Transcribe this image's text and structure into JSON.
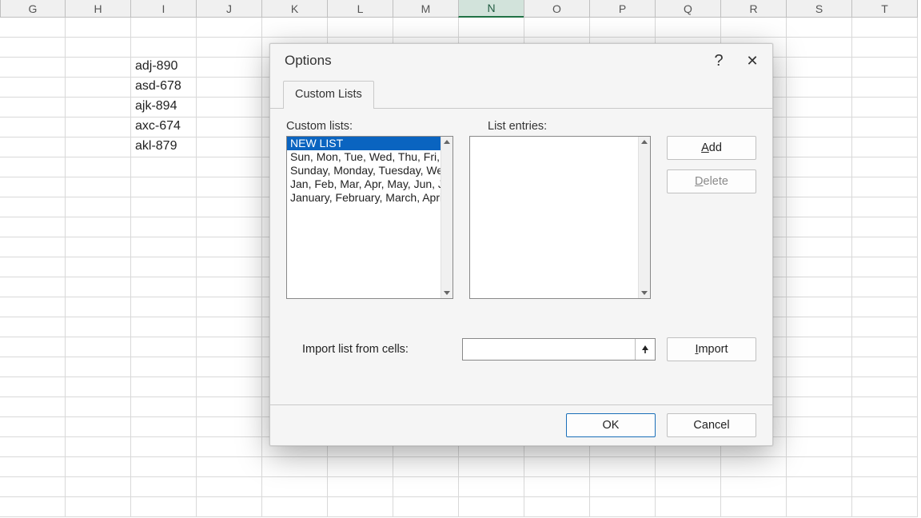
{
  "columns": [
    "G",
    "H",
    "I",
    "J",
    "K",
    "L",
    "M",
    "N",
    "O",
    "P",
    "Q",
    "R",
    "S",
    "T"
  ],
  "active_column": "N",
  "cell_values": {
    "I4": "adj-890",
    "I5": "asd-678",
    "I6": "ajk-894",
    "I7": "axc-674",
    "I8": "akl-879"
  },
  "dialog": {
    "title": "Options",
    "help": "?",
    "close": "✕",
    "tab_label": "Custom Lists",
    "custom_lists_label": "Custom lists:",
    "list_entries_label": "List entries:",
    "lists": [
      "NEW LIST",
      "Sun, Mon, Tue, Wed, Thu, Fri,",
      "Sunday, Monday, Tuesday, We",
      "Jan, Feb, Mar, Apr, May, Jun, Ju",
      "January, February, March, Apri"
    ],
    "selected_list_index": 0,
    "add_label": "Add",
    "delete_label": "Delete",
    "import_from_label": "Import list from cells:",
    "import_value": "",
    "import_button": "Import",
    "ok_label": "OK",
    "cancel_label": "Cancel"
  }
}
